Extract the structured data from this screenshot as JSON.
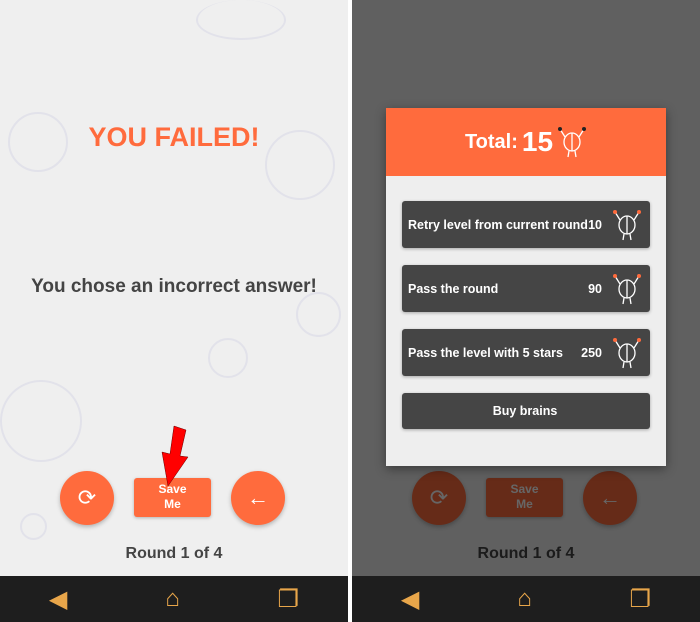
{
  "left": {
    "title": "YOU FAILED!",
    "message": "You chose an incorrect answer!",
    "save_me_label": "Save\nMe",
    "save_me_line1": "Save",
    "save_me_line2": "Me",
    "round": "Round 1 of 4"
  },
  "dialog": {
    "total_label": "Total:",
    "total_value": "15",
    "options": [
      {
        "label": "Retry level from current round",
        "cost": "10"
      },
      {
        "label": "Pass the round",
        "cost": "90"
      },
      {
        "label": "Pass the level with 5 stars",
        "cost": "250"
      }
    ],
    "buy_label": "Buy brains"
  },
  "colors": {
    "accent": "#ff6b3d",
    "option_bg": "#454545",
    "nav_bg": "#1e1e1e",
    "annotation_arrow": "#ff0000"
  },
  "icons": {
    "retry": "refresh-icon",
    "back": "arrow-left-icon",
    "currency": "brain-icon",
    "nav": [
      "back-icon",
      "home-icon",
      "recent-apps-icon"
    ]
  }
}
